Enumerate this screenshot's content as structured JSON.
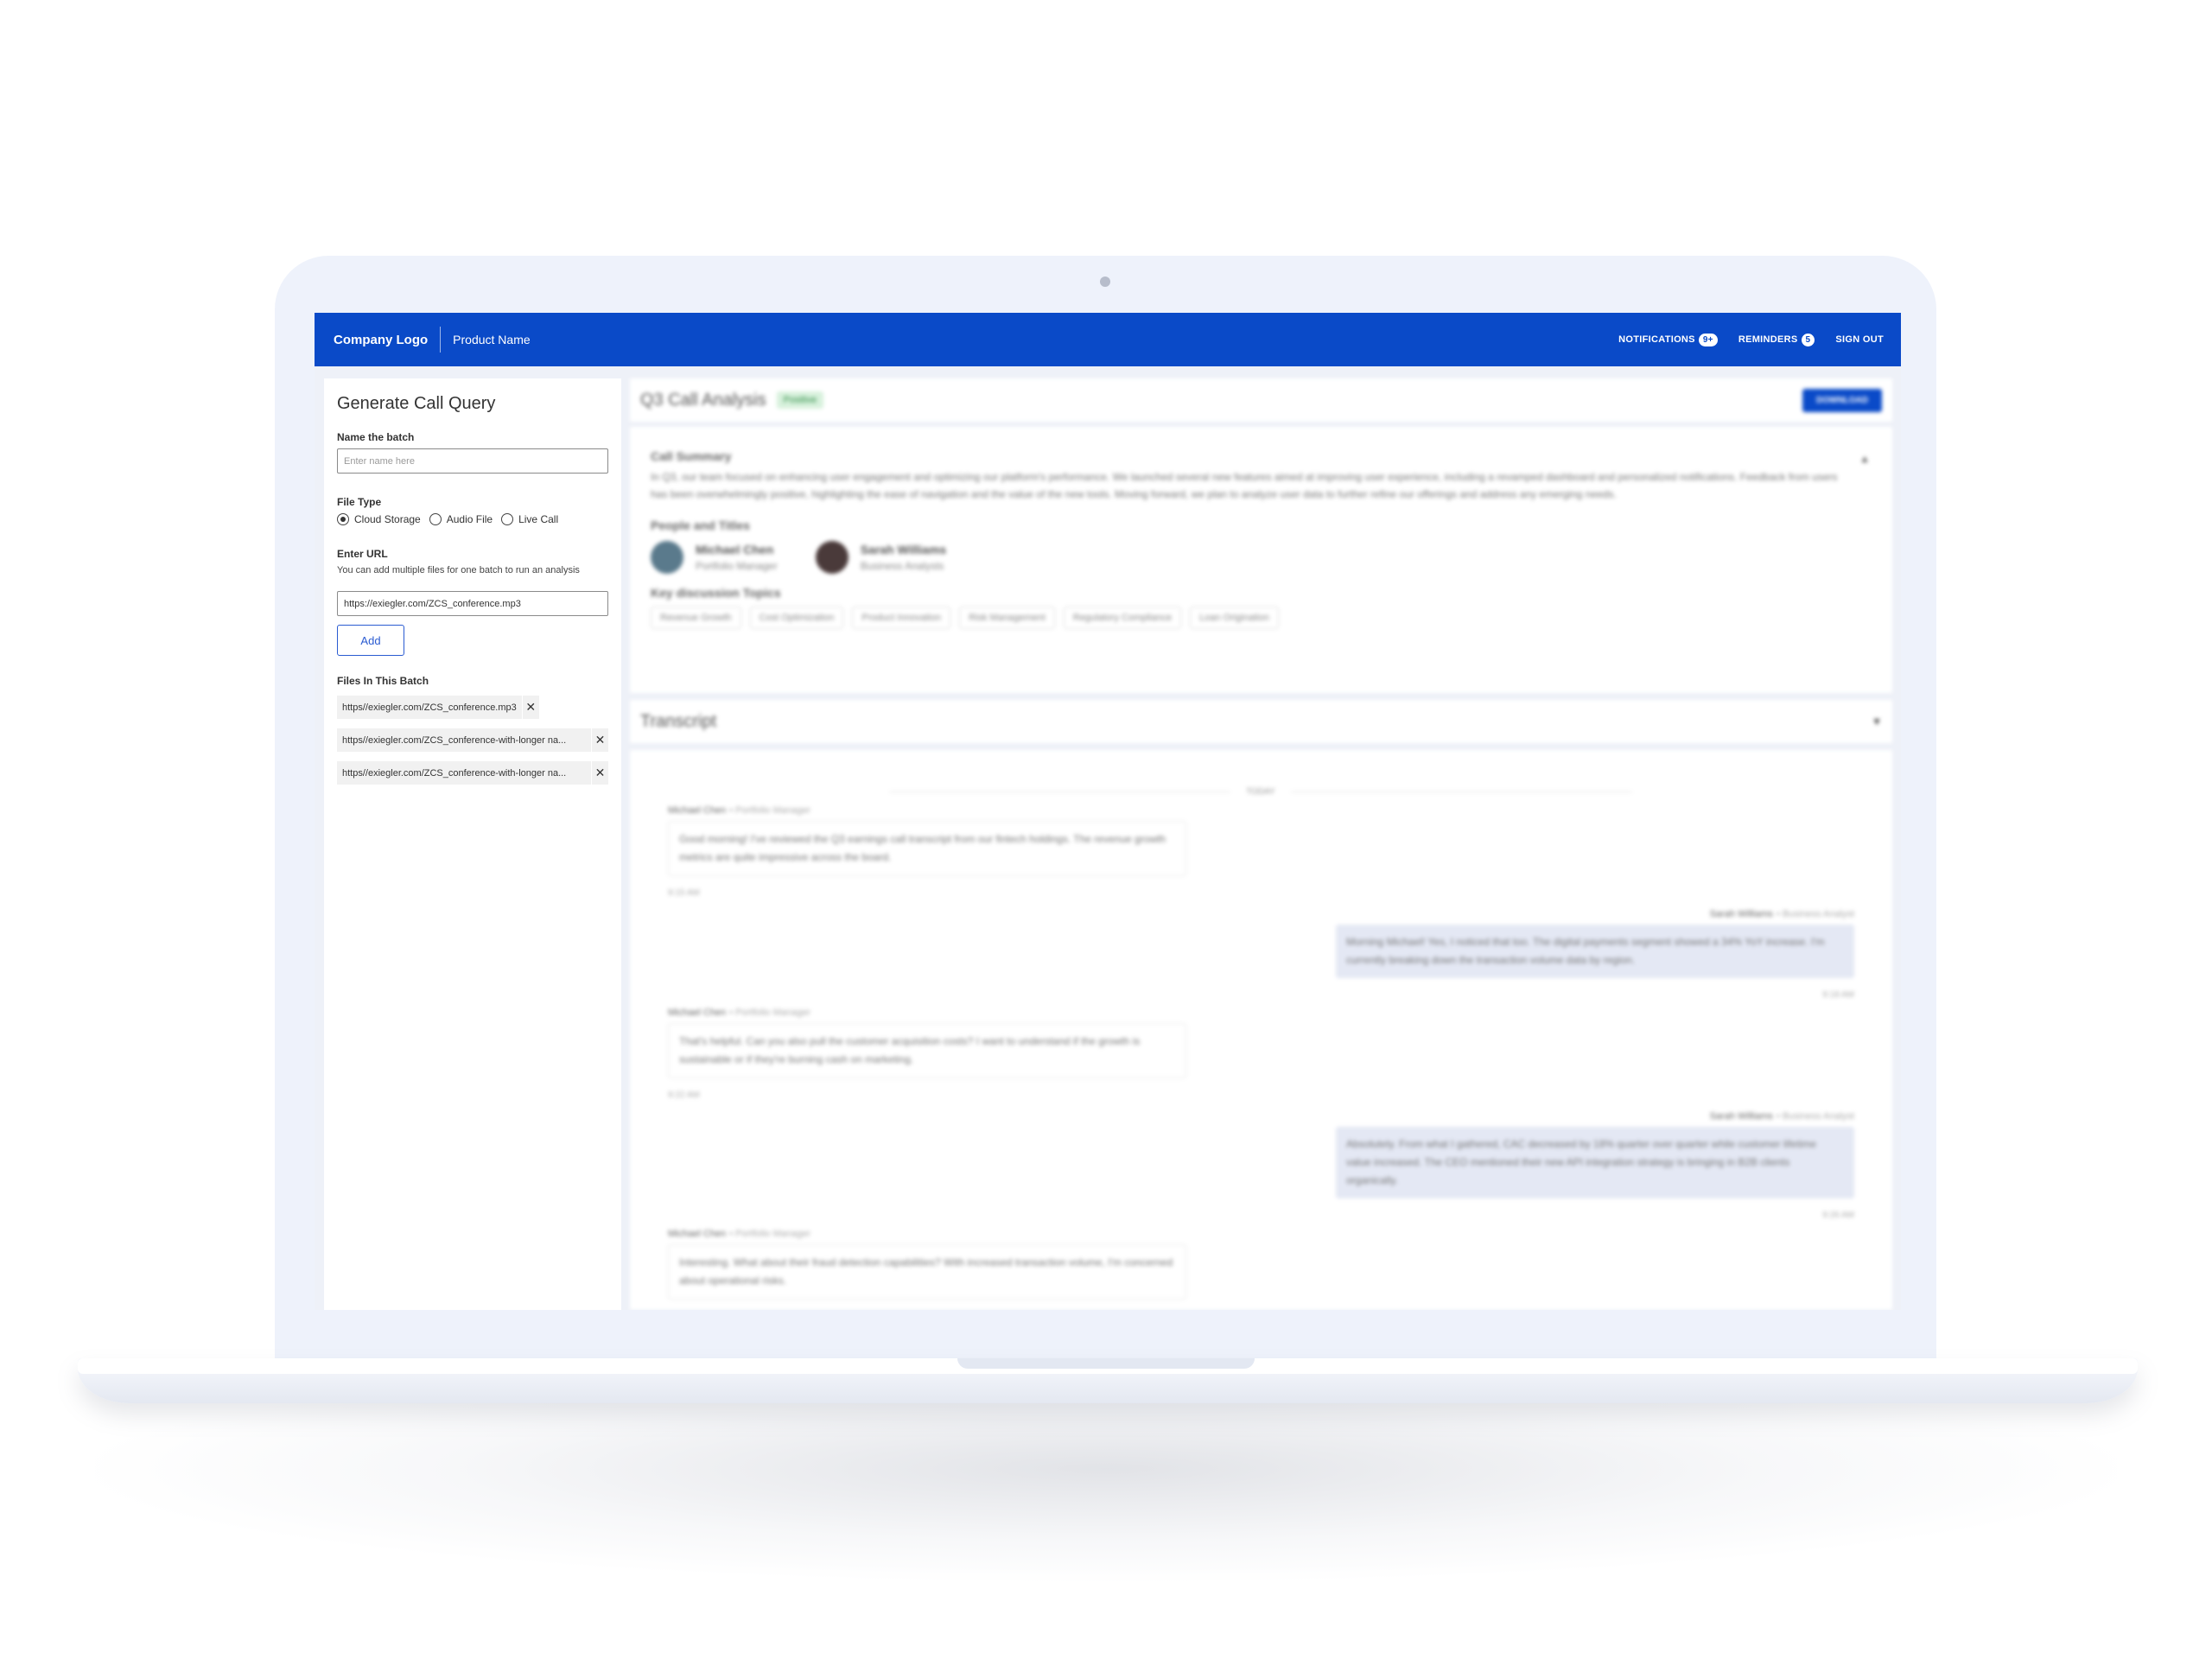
{
  "header": {
    "logo": "Company Logo",
    "product": "Product Name",
    "notifications": {
      "label": "NOTIFICATIONS",
      "count": "9+"
    },
    "reminders": {
      "label": "REMINDERS",
      "count": "5"
    },
    "sign_out": "SIGN OUT"
  },
  "form": {
    "title": "Generate Call Query",
    "batch_name": {
      "label": "Name the batch",
      "placeholder": "Enter name here",
      "value": ""
    },
    "file_type": {
      "label": "File Type",
      "options": [
        "Cloud Storage",
        "Audio File",
        "Live Call"
      ],
      "selected": "Cloud Storage"
    },
    "url": {
      "label": "Enter URL",
      "hint": "You can add multiple files for one batch to run an analysis",
      "value": "https://exiegler.com/ZCS_conference.mp3"
    },
    "add_label": "Add",
    "files": {
      "label": "Files In This Batch",
      "items": [
        "https//exiegler.com/ZCS_conference.mp3",
        "https//exiegler.com/ZCS_conference-with-longer na...",
        "https//exiegler.com/ZCS_conference-with-longer na..."
      ]
    }
  },
  "analysis": {
    "title": "Q3 Call Analysis",
    "sentiment": "Positive",
    "download": "DOWNLOAD"
  },
  "summary": {
    "heading": "Call Summary",
    "text": "In Q3, our team focused on enhancing user engagement and optimizing our platform's performance. We launched several new features aimed at improving user experience, including a revamped dashboard and personalized notifications. Feedback from users has been overwhelmingly positive, highlighting the ease of navigation and the value of the new tools. Moving forward, we plan to analyze user data to further refine our offerings and address any emerging needs.",
    "people_heading": "People and Titles",
    "people": [
      {
        "name": "Michael Chen",
        "role": "Portfolio Manager"
      },
      {
        "name": "Sarah Williams",
        "role": "Business Analysts"
      }
    ],
    "topics_heading": "Key discussion Topics",
    "topics": [
      "Revenue Growth",
      "Cost Optimization",
      "Product Innovation",
      "Risk Management",
      "Regulatory Compliance",
      "Loan Origination"
    ]
  },
  "transcript": {
    "title": "Transcript",
    "day_label": "TODAY",
    "messages": [
      {
        "name": "Michael Chen",
        "role": "• Portfolio Manager",
        "text": "Good morning! I've reviewed the Q3 earnings call transcript from our fintech holdings. The revenue growth metrics are quite impressive across the board.",
        "time": "9:15 AM"
      },
      {
        "name": "Sarah Williams",
        "role": "• Business Analyst",
        "text": "Morning Michael! Yes, I noticed that too. The digital payments segment showed a 34% YoY increase. I'm currently breaking down the transaction volume data by region.",
        "time": "9:18 AM"
      },
      {
        "name": "Michael Chen",
        "role": "• Portfolio Manager",
        "text": "That's helpful. Can you also pull the customer acquisition costs? I want to understand if the growth is sustainable or if they're burning cash on marketing.",
        "time": "9:22 AM"
      },
      {
        "name": "Sarah Williams",
        "role": "• Business Analyst",
        "text": "Absolutely. From what I gathered, CAC decreased by 18% quarter over quarter while customer lifetime value increased. The CEO mentioned their new API integration strategy is bringing in B2B clients organically.",
        "time": "9:26 AM"
      },
      {
        "name": "Michael Chen",
        "role": "• Portfolio Manager",
        "text": "Interesting. What about their fraud detection capabilities? With increased transaction volume, I'm concerned about operational risks.",
        "time": ""
      }
    ]
  },
  "colors": {
    "brand": "#0a4ac8",
    "positive_bg": "#d7f1dc",
    "bubble_right": "#e4e8f4"
  },
  "icons": [
    "radio-icon",
    "close-icon",
    "chevron-up-icon",
    "chevron-down-icon"
  ]
}
